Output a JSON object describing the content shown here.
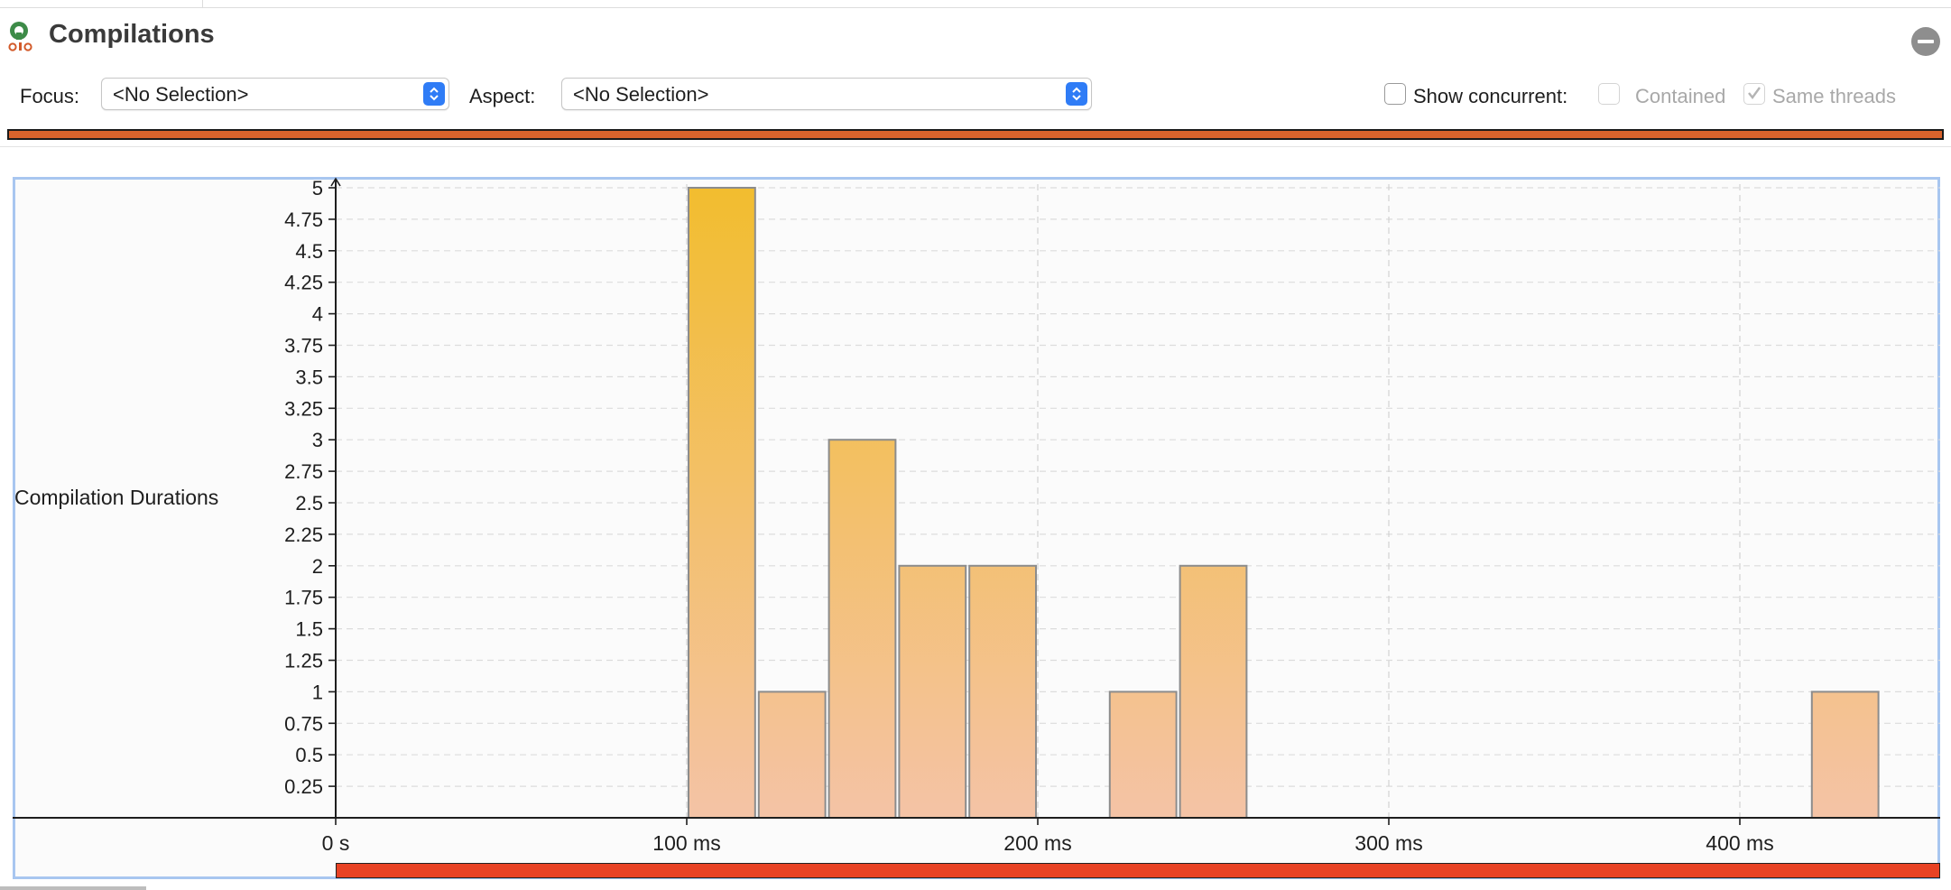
{
  "panel": {
    "title": "Compilations",
    "icon": "compilations-app-icon",
    "minimize_icon": "minimize-icon"
  },
  "toolbar": {
    "focus_label": "Focus:",
    "focus_value": "<No Selection>",
    "aspect_label": "Aspect:",
    "aspect_value": "<No Selection>",
    "show_concurrent_label": "Show concurrent:",
    "show_concurrent_checked": false,
    "contained_label": "Contained",
    "contained_checked": false,
    "same_threads_label": "Same threads",
    "same_threads_checked": true
  },
  "colors": {
    "overview_bar": "#d9632c",
    "range_bar": "#e84224",
    "bar_top": "#f2bd2f",
    "bar_bottom": "#f4c3a6",
    "frame": "#a8c6f0",
    "accent": "#2f7cf6"
  },
  "chart_data": {
    "type": "bar",
    "ylabel": "Compilation Durations",
    "xlabel": "",
    "x_unit": "ms",
    "xlim": [
      0,
      460
    ],
    "ylim": [
      0,
      5
    ],
    "y_ticks": [
      "5",
      "4.75",
      "4.5",
      "4.25",
      "4",
      "3.75",
      "3.5",
      "3.25",
      "3",
      "2.75",
      "2.5",
      "2.25",
      "2",
      "1.75",
      "1.5",
      "1.25",
      "1",
      "0.75",
      "0.5",
      "0.25"
    ],
    "x_ticks": [
      {
        "value": 0,
        "label": "0 s"
      },
      {
        "value": 100,
        "label": "100 ms"
      },
      {
        "value": 200,
        "label": "200 ms"
      },
      {
        "value": 300,
        "label": "300 ms"
      },
      {
        "value": 400,
        "label": "400 ms"
      }
    ],
    "grid": true,
    "bars": [
      {
        "start": 100,
        "end": 120,
        "value": 5
      },
      {
        "start": 120,
        "end": 140,
        "value": 1
      },
      {
        "start": 140,
        "end": 160,
        "value": 3
      },
      {
        "start": 160,
        "end": 180,
        "value": 2
      },
      {
        "start": 180,
        "end": 200,
        "value": 2
      },
      {
        "start": 220,
        "end": 240,
        "value": 1
      },
      {
        "start": 240,
        "end": 260,
        "value": 2
      },
      {
        "start": 420,
        "end": 440,
        "value": 1
      }
    ]
  }
}
